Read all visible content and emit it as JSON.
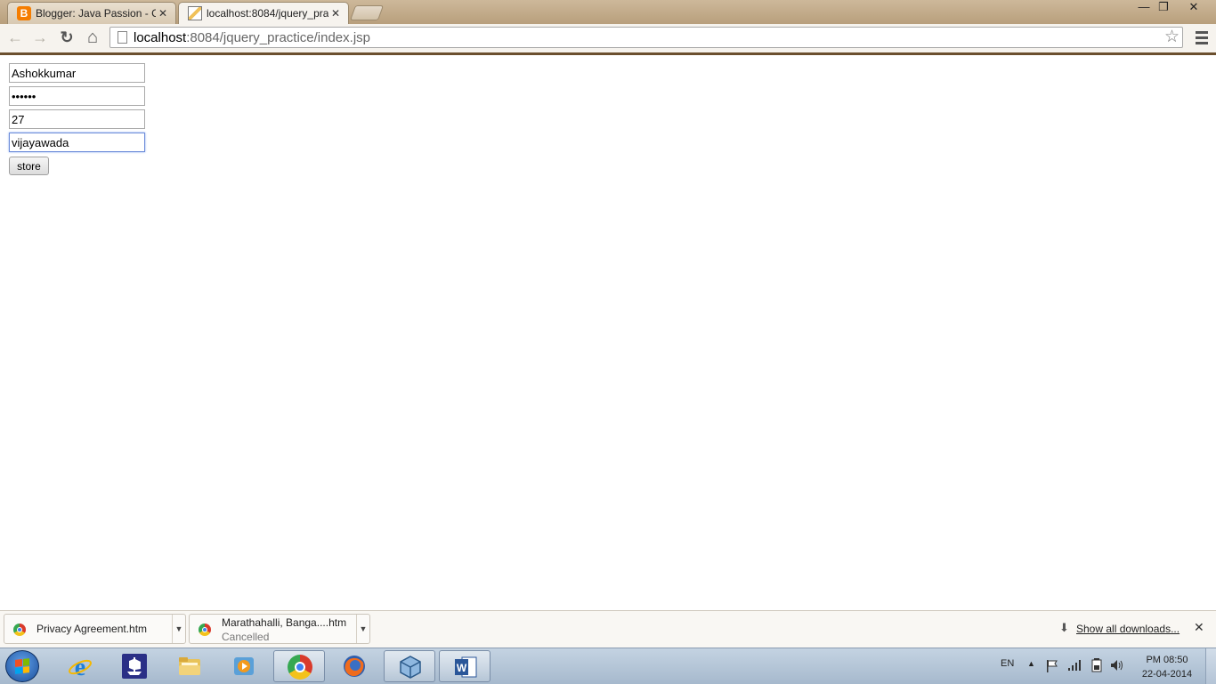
{
  "browser": {
    "tabs": [
      {
        "title": "Blogger: Java Passion - Cr",
        "active": false
      },
      {
        "title": "localhost:8084/jquery_pra",
        "active": true
      }
    ],
    "window_controls": {
      "minimize": "—",
      "restore": "❐",
      "close": "✕"
    },
    "nav": {
      "back": "←",
      "forward": "→",
      "reload": "↻",
      "home": "⌂"
    },
    "address": {
      "host": "localhost",
      "rest": ":8084/jquery_practice/index.jsp"
    },
    "star": "☆"
  },
  "form": {
    "name_value": "Ashokkumar",
    "password_value": "123456",
    "age_value": "27",
    "city_value": "vijayawada",
    "store_label": "store"
  },
  "downloads": {
    "items": [
      {
        "name": "Privacy Agreement.htm",
        "status": ""
      },
      {
        "name": "Marathahalli, Banga....htm",
        "status": "Cancelled"
      }
    ],
    "show_all": "Show all downloads...",
    "close": "✕"
  },
  "taskbar": {
    "apps": [
      "internet-explorer",
      "pirate-ship",
      "file-explorer",
      "media-player",
      "chrome",
      "firefox",
      "virtualbox",
      "word"
    ],
    "language": "EN",
    "clock_time": "PM 08:50",
    "clock_date": "22-04-2014"
  },
  "colors": {
    "frame": "#b89f7c",
    "toolbar": "#f6f3ee",
    "toolbar_border": "#6b4f2e",
    "taskbar": "#a6b9cd",
    "focus": "#6d8cd9"
  }
}
